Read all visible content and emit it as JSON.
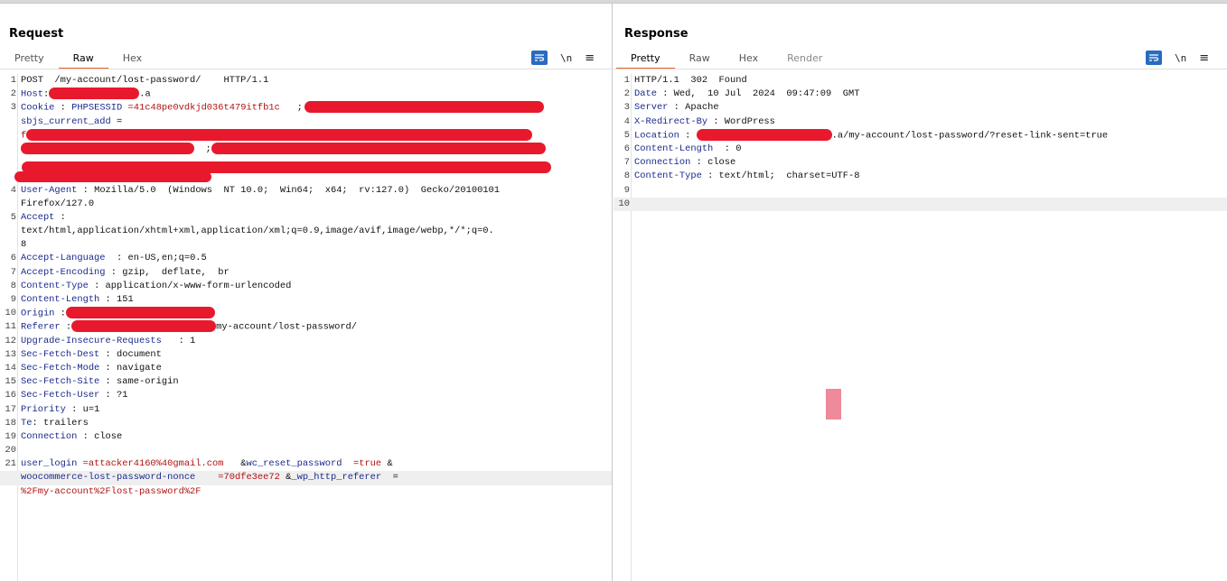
{
  "request": {
    "title": "Request",
    "tabs": [
      {
        "label": "Pretty"
      },
      {
        "label": "Raw"
      },
      {
        "label": "Hex"
      }
    ],
    "tools": {
      "newline_label": "\\n",
      "menu_label": "≡"
    },
    "lines": {
      "l1": "POST  /my-account/lost-password/    HTTP/1.1",
      "host_key": "Host",
      "host_suffix": ".a",
      "cookie_key": "Cookie",
      "cookie_name": "PHPSESSID",
      "cookie_val": "=41c48pe0vdkjd036t479itfb1c",
      "cookie_sep": ";",
      "sbjs": "sbjs_current_add",
      "sbjs_eq": " =",
      "cookie_cont": "f",
      "cookie_semi": ";",
      "ua_key": "User-Agent",
      "ua_val": "Mozilla/5.0  (Windows  NT 10.0;  Win64;  x64;  rv:127.0)  Gecko/20100101",
      "ua_cont": "Firefox/127.0",
      "accept_key": "Accept",
      "accept_val1": "text/html,application/xhtml+xml,application/xml;q=0.9,image/avif,image/webp,*/*;q=0.",
      "accept_val2": "8",
      "al_key": "Accept-Language",
      "al_val": "en-US,en;q=0.5",
      "ae_key": "Accept-Encoding",
      "ae_val": "gzip,  deflate,  br",
      "ct_key": "Content-Type",
      "ct_val": "application/x-www-form-urlencoded",
      "cl_key": "Content-Length",
      "cl_val": "151",
      "origin_key": "Origin",
      "ref_key": "Referer",
      "ref_val": "my-account/lost-password/",
      "uir_key": "Upgrade-Insecure-Requests",
      "uir_val": "1",
      "sfd_key": "Sec-Fetch-Dest",
      "sfd_val": "document",
      "sfm_key": "Sec-Fetch-Mode",
      "sfm_val": "navigate",
      "sfs_key": "Sec-Fetch-Site",
      "sfs_val": "same-origin",
      "sfu_key": "Sec-Fetch-User",
      "sfu_val": "?1",
      "pri_key": "Priority",
      "pri_val": "u=1",
      "te_key": "Te",
      "te_val": "trailers",
      "conn_key": "Connection",
      "conn_val": "close",
      "b_login": "user_login",
      "b_login_val": "=attacker4160%40gmail.com",
      "b_amp1": "&",
      "b_reset": "wc_reset_password",
      "b_reset_val": "=true",
      "b_amp2": "&",
      "b_nonce": "woocommerce-lost-password-nonce",
      "b_nonce_val": "=70dfe3ee72",
      "b_amp3": "&",
      "b_ref": "_wp_http_referer",
      "b_ref_eq": "=",
      "b_ref_val": "%2Fmy-account%2Flost-password%2F"
    },
    "line_numbers": [
      "1",
      "2",
      "3",
      "4",
      "5",
      "6",
      "7",
      "8",
      "9",
      "10",
      "11",
      "12",
      "13",
      "14",
      "15",
      "16",
      "17",
      "18",
      "19",
      "20",
      "21"
    ]
  },
  "response": {
    "title": "Response",
    "tabs": [
      {
        "label": "Pretty"
      },
      {
        "label": "Raw"
      },
      {
        "label": "Hex"
      },
      {
        "label": "Render"
      }
    ],
    "tools": {
      "newline_label": "\\n",
      "menu_label": "≡"
    },
    "lines": {
      "l1": "HTTP/1.1  302  Found",
      "date_key": "Date",
      "date_val": "Wed,  10 Jul  2024  09:47:09  GMT",
      "server_key": "Server",
      "server_val": "Apache",
      "xrb_key": "X-Redirect-By",
      "xrb_val": "WordPress",
      "loc_key": "Location",
      "loc_val": ".a/my-account/lost-password/?reset-link-sent=true",
      "cl_key": "Content-Length",
      "cl_val": "0",
      "conn_key": "Connection",
      "conn_val": "close",
      "ct_key": "Content-Type",
      "ct_val": "text/html;  charset=UTF-8"
    },
    "line_numbers": [
      "1",
      "2",
      "3",
      "4",
      "5",
      "6",
      "7",
      "8",
      "9",
      "10"
    ]
  },
  "colors": {
    "accent": "#e8622a",
    "blue": "#2a6bbf",
    "key": "#1a2a8c",
    "value": "#b11212",
    "redaction": "#e8192c"
  }
}
